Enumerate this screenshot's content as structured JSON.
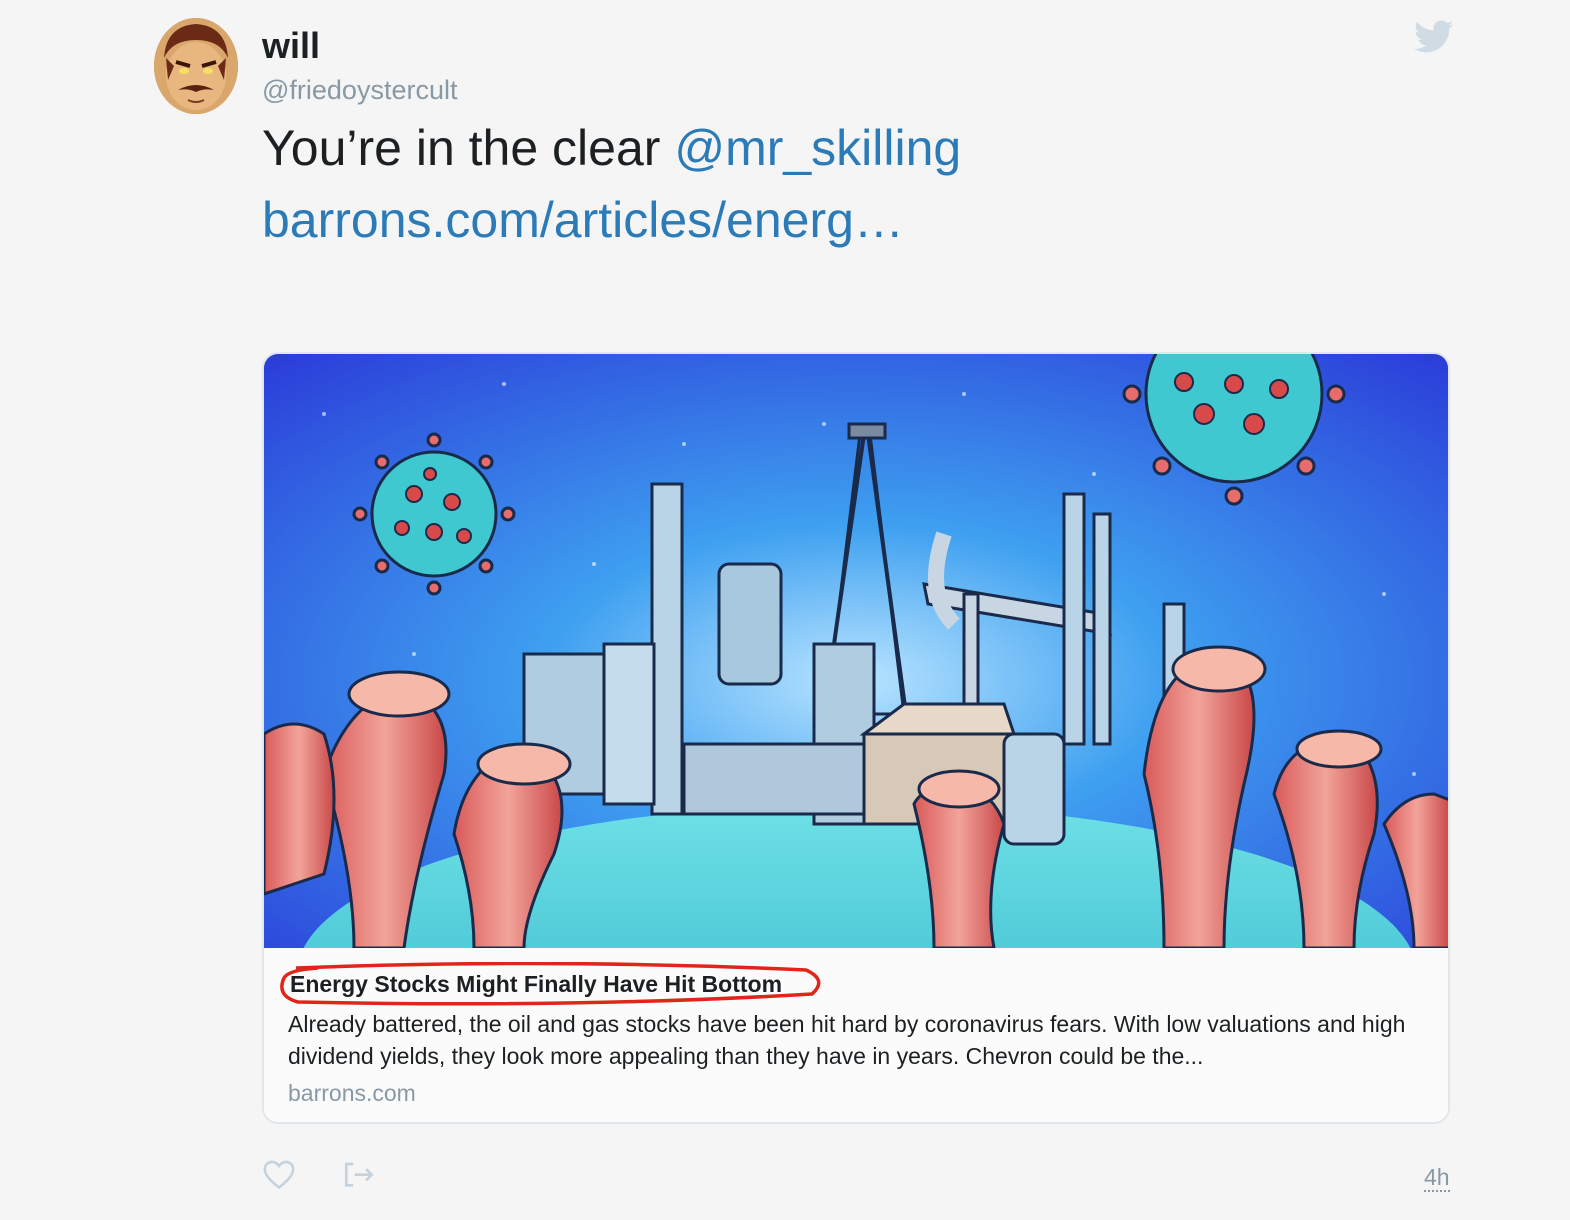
{
  "user": {
    "display_name": "will",
    "handle": "@friedoystercult",
    "avatar_icon": "cartoon-avatar-icon"
  },
  "tweet": {
    "text_prefix": "You’re in the clear ",
    "mention": "@mr_skilling",
    "link": "barrons.com/articles/energ…",
    "timestamp": "4h"
  },
  "card": {
    "title": "Energy Stocks Might Finally Have Hit Bottom",
    "description": "Already battered, the oil and gas stocks have been hit hard by coronavirus fears. With low valuations and high dividend yields, they look more appealing than they have in years. Chevron could be the...",
    "domain": "barrons.com",
    "image_icon": "oil-refinery-coronavirus-illustration"
  },
  "icons": {
    "bird": "twitter-bird-icon",
    "like": "heart-icon",
    "share": "share-icon"
  },
  "colors": {
    "link": "#2b7bb9",
    "muted": "#8899a6",
    "annotation": "#e0261b"
  }
}
